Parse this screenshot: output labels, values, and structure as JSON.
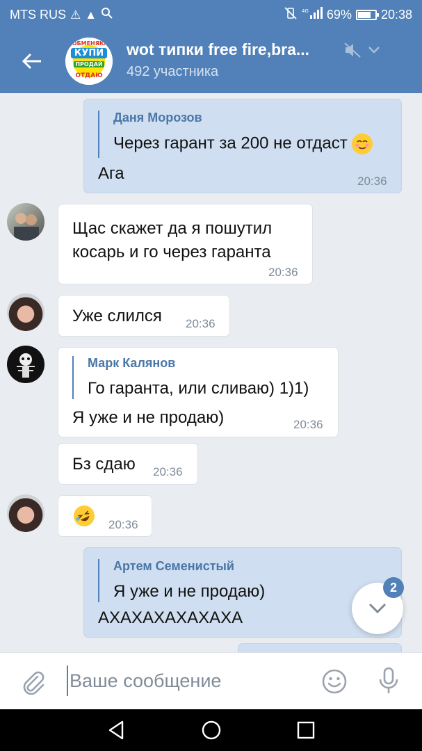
{
  "status_bar": {
    "carrier": "MTS RUS",
    "battery": "69%",
    "battery_level": 0.69,
    "time": "20:38"
  },
  "header": {
    "title": "wot типки free fire,bra...",
    "subtitle": "492 участника",
    "avatar_lines": [
      "ОБМЕНЯЮ",
      "КУПИ",
      "ПРОДАЙ",
      "ОТДАЮ"
    ]
  },
  "messages": [
    {
      "reply_author": "Даня Морозов",
      "reply_text": "Через гарант за 200 не отдаст",
      "text": "Ага",
      "time": "20:36"
    },
    {
      "text_line1": "Щас скажет да я пошутил",
      "text_line2": "косарь и го через гаранта",
      "time": "20:36"
    },
    {
      "text": "Уже слился",
      "time": "20:36"
    },
    {
      "reply_author": "Марк Калянов",
      "reply_text": "Го гаранта, или сливаю) 1)1)",
      "text": "Я уже и не продаю)",
      "time": "20:36"
    },
    {
      "text": "Бз сдаю",
      "time": "20:36"
    },
    {
      "emoji": "rofl-emoji",
      "time": "20:36"
    },
    {
      "reply_author": "Артем Семенистый",
      "reply_text": "Я уже и не продаю)",
      "text": "АХАХАХАХАХАХА"
    }
  ],
  "scroll_button": {
    "badge": "2"
  },
  "composer": {
    "placeholder": "Ваше сообщение"
  },
  "colors": {
    "header_blue": "#5181b8",
    "outgoing_bubble": "#cfdef0",
    "incoming_bubble": "#ffffff",
    "background": "#e9ecf0"
  }
}
